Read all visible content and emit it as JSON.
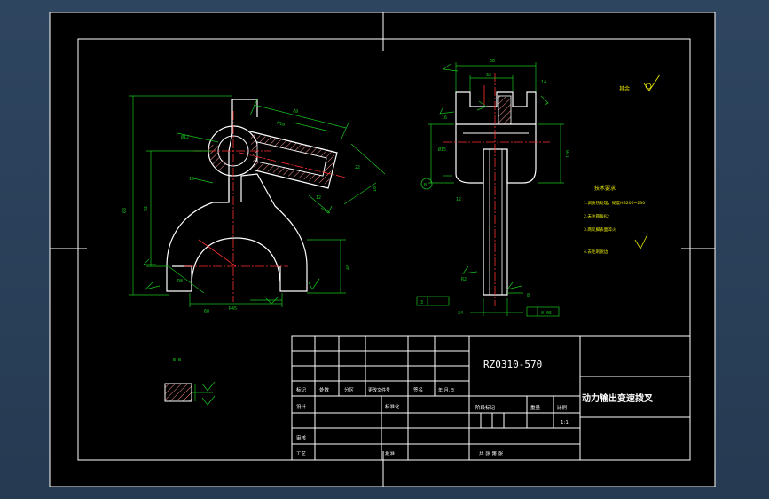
{
  "drawing": {
    "part_number": "RZ0310-570",
    "part_name": "动力输出变速拨叉",
    "section_label": "B-B",
    "section_callout": "B",
    "roughness_note": "其余",
    "scale": "1:1"
  },
  "technical_requirements": {
    "title": "技术要求",
    "lines": [
      "1.调质热处理，硬度HB200~230",
      "2.未注圆角R2",
      "3.两叉脚表面淬火",
      "4.去毛刺锐边"
    ]
  },
  "title_block": {
    "header_row": [
      "标记",
      "处数",
      "分区",
      "更改文件号",
      "签名",
      "年.月.日"
    ],
    "rows_left": [
      "设计",
      "",
      "审核",
      "工艺"
    ],
    "standardization": "标准化",
    "approval": "批准",
    "stage_label": "阶段标记",
    "weight_label": "重量",
    "scale_label": "比例",
    "sheet_label": "共  张  第  张"
  },
  "dimensions": {
    "front": [
      "68",
      "52",
      "R45",
      "Ø12",
      "15",
      "R8",
      "48",
      "M10",
      "20",
      "22",
      "10",
      "60",
      "12"
    ],
    "side": [
      "38",
      "32",
      "14",
      "Ø15",
      "12",
      "120",
      "8",
      "24",
      "3",
      "R2",
      "16",
      "0.05"
    ]
  },
  "colors": {
    "background": "#000000",
    "border": "#ffffff",
    "outline": "#ffffff",
    "dimension": "#19c51e",
    "centerline": "#ff3030",
    "hatch": "#ff8f8f"
  }
}
